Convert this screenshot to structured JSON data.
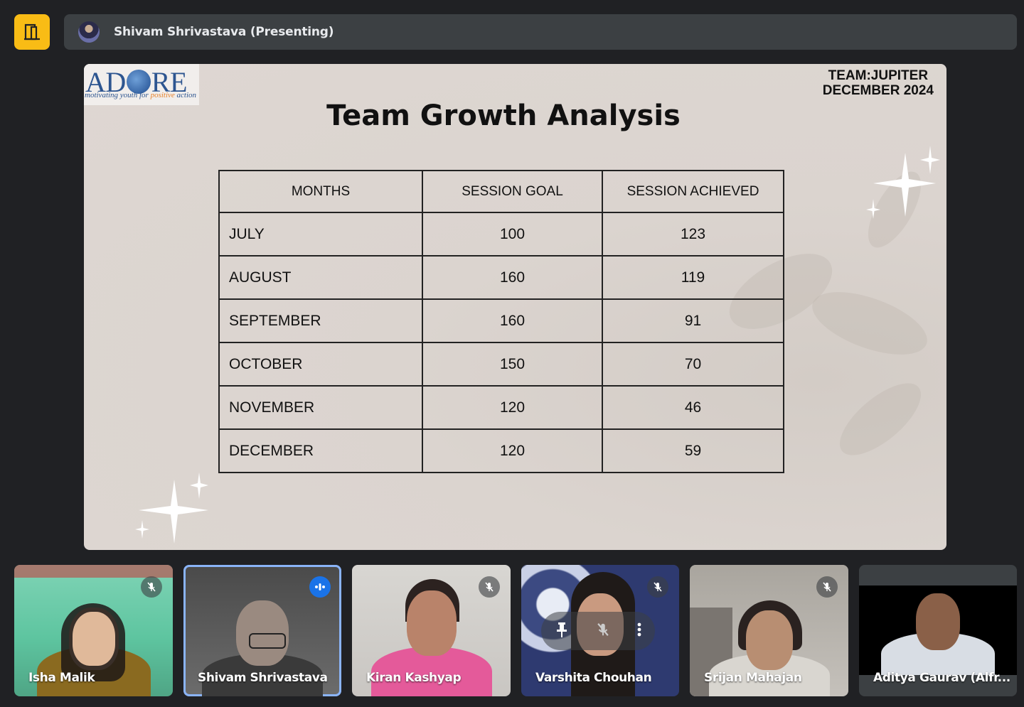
{
  "header": {
    "presenter": "Shivam Shrivastava (Presenting)"
  },
  "slide": {
    "logo_word_left": "AD",
    "logo_word_right": "RE",
    "logo_tag_part1": "motivating youth for ",
    "logo_tag_highlight": "positive",
    "logo_tag_part2": " action",
    "team": "TEAM:JUPITER",
    "date": "DECEMBER 2024",
    "title": "Team Growth Analysis",
    "table": {
      "headers": [
        "MONTHS",
        "SESSION GOAL",
        "SESSION ACHIEVED"
      ],
      "rows": [
        [
          "JULY",
          "100",
          "123"
        ],
        [
          "AUGUST",
          "160",
          "119"
        ],
        [
          "SEPTEMBER",
          "160",
          "91"
        ],
        [
          "OCTOBER",
          "150",
          "70"
        ],
        [
          "NOVEMBER",
          "120",
          "46"
        ],
        [
          "DECEMBER",
          "120",
          "59"
        ]
      ]
    }
  },
  "participants": [
    {
      "name": "Isha Malik",
      "status": "muted"
    },
    {
      "name": "Shivam Shrivastava",
      "status": "speaking"
    },
    {
      "name": "Kiran Kashyap",
      "status": "muted"
    },
    {
      "name": "Varshita Chouhan",
      "status": "muted"
    },
    {
      "name": "Srijan Mahajan",
      "status": "muted"
    },
    {
      "name": "Aditya Gaurav (Alfr...",
      "status": "unknown"
    }
  ],
  "colors": {
    "background": "#202124",
    "accent_yellow": "#f9bc15",
    "speaking_blue": "#1a73e8",
    "active_border": "#8ab4f8"
  }
}
